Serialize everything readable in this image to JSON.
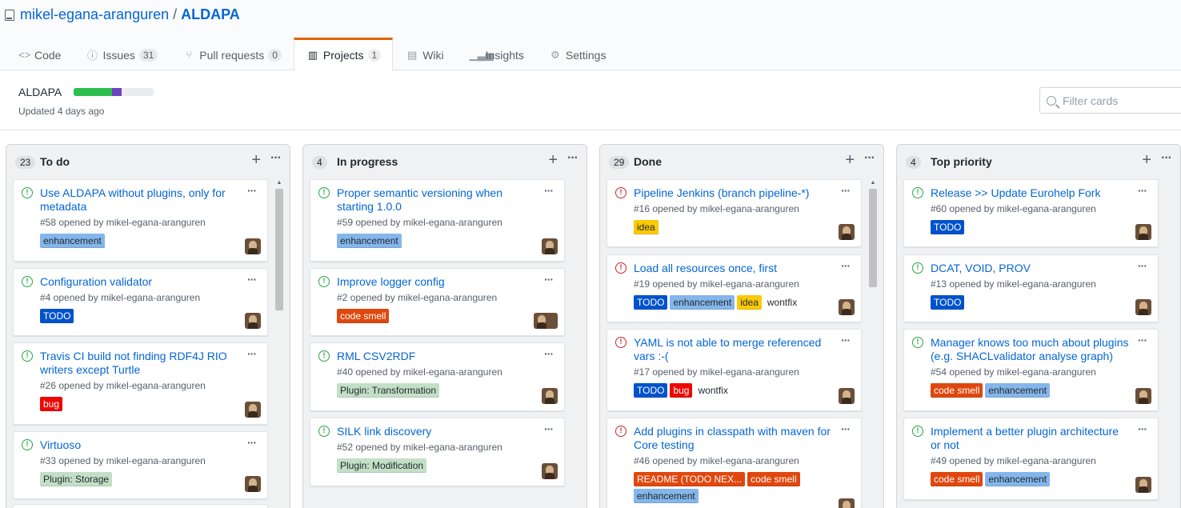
{
  "repo": {
    "owner": "mikel-egana-aranguren",
    "separator": "/",
    "name": "ALDAPA"
  },
  "tabs": [
    {
      "label": "Code",
      "counter": ""
    },
    {
      "label": "Issues",
      "counter": "31"
    },
    {
      "label": "Pull requests",
      "counter": "0"
    },
    {
      "label": "Projects",
      "counter": "1"
    },
    {
      "label": "Wiki",
      "counter": ""
    },
    {
      "label": "Insights",
      "counter": ""
    },
    {
      "label": "Settings",
      "counter": ""
    }
  ],
  "project": {
    "name": "ALDAPA",
    "updated": "Updated 4 days ago",
    "progress": {
      "done_fraction": 0.48,
      "in_progress_fraction": 0.12
    },
    "filter_placeholder": "Filter cards"
  },
  "colors": {
    "enhancement": "#84b6eb",
    "todo": "#0052cc",
    "bug": "#ee0701",
    "code_smell": "#e0470e",
    "plugin": "#c2e0c6",
    "idea": "#fbca04",
    "link": "#0366d6",
    "open": "#28a745",
    "closed": "#cb2431"
  },
  "columns": [
    {
      "title": "To do",
      "count": "23",
      "cards": [
        {
          "title": "Use ALDAPA without plugins, only for metadata",
          "meta": "#58 opened by mikel-egana-aranguren",
          "state": "open",
          "labels": [
            {
              "text": "enhancement",
              "kind": "enhancement"
            }
          ]
        },
        {
          "title": "Configuration validator",
          "meta": "#4 opened by mikel-egana-aranguren",
          "state": "open",
          "labels": [
            {
              "text": "TODO",
              "kind": "todo"
            }
          ]
        },
        {
          "title": "Travis CI build not finding RDF4J RIO writers except Turtle",
          "meta": "#26 opened by mikel-egana-aranguren",
          "state": "open",
          "labels": [
            {
              "text": "bug",
              "kind": "bug"
            }
          ]
        },
        {
          "title": "Virtuoso",
          "meta": "#33 opened by mikel-egana-aranguren",
          "state": "open",
          "labels": [
            {
              "text": "Plugin: Storage",
              "kind": "plugin"
            }
          ]
        }
      ]
    },
    {
      "title": "In progress",
      "count": "4",
      "cards": [
        {
          "title": "Proper semantic versioning when starting 1.0.0",
          "meta": "#59 opened by mikel-egana-aranguren",
          "state": "open",
          "labels": [
            {
              "text": "enhancement",
              "kind": "enhancement"
            }
          ]
        },
        {
          "title": "Improve logger config",
          "meta": "#2 opened by mikel-egana-aranguren",
          "state": "open",
          "labels": [
            {
              "text": "code smell",
              "kind": "code_smell"
            }
          ]
        },
        {
          "title": "RML CSV2RDF",
          "meta": "#40 opened by mikel-egana-aranguren",
          "state": "open",
          "labels": [
            {
              "text": "Plugin: Transformation",
              "kind": "plugin"
            }
          ]
        },
        {
          "title": "SILK link discovery",
          "meta": "#52 opened by mikel-egana-aranguren",
          "state": "open",
          "labels": [
            {
              "text": "Plugin: Modification",
              "kind": "plugin"
            }
          ]
        }
      ]
    },
    {
      "title": "Done",
      "count": "29",
      "cards": [
        {
          "title": "Pipeline Jenkins (branch pipeline-*)",
          "meta": "#16 opened by mikel-egana-aranguren",
          "state": "closed",
          "labels": [
            {
              "text": "idea",
              "kind": "idea"
            }
          ]
        },
        {
          "title": "Load all resources once, first",
          "meta": "#19 opened by mikel-egana-aranguren",
          "state": "closed",
          "labels": [
            {
              "text": "TODO",
              "kind": "todo"
            },
            {
              "text": "enhancement",
              "kind": "enhancement"
            },
            {
              "text": "idea",
              "kind": "idea"
            },
            {
              "text": "wontfix",
              "kind": "plain"
            }
          ]
        },
        {
          "title": "YAML is not able to merge referenced vars :-(",
          "meta": "#17 opened by mikel-egana-aranguren",
          "state": "closed",
          "labels": [
            {
              "text": "TODO",
              "kind": "todo"
            },
            {
              "text": "bug",
              "kind": "bug"
            },
            {
              "text": "wontfix",
              "kind": "plain"
            }
          ]
        },
        {
          "title": "Add plugins in classpath with maven for Core testing",
          "meta": "#46 opened by mikel-egana-aranguren",
          "state": "closed",
          "labels": [
            {
              "text": "README (TODO NEX...",
              "kind": "code_smell"
            },
            {
              "text": "code smell",
              "kind": "code_smell"
            },
            {
              "text": "enhancement",
              "kind": "enhancement"
            }
          ]
        }
      ]
    },
    {
      "title": "Top priority",
      "count": "4",
      "cards": [
        {
          "title": "Release >> Update Eurohelp Fork",
          "meta": "#60 opened by mikel-egana-aranguren",
          "state": "open",
          "labels": [
            {
              "text": "TODO",
              "kind": "todo"
            }
          ]
        },
        {
          "title": "DCAT, VOID, PROV",
          "meta": "#13 opened by mikel-egana-aranguren",
          "state": "open",
          "labels": [
            {
              "text": "TODO",
              "kind": "todo"
            }
          ]
        },
        {
          "title": "Manager knows too much about plugins (e.g. SHACLvalidator analyse graph)",
          "meta": "#54 opened by mikel-egana-aranguren",
          "state": "open",
          "labels": [
            {
              "text": "code smell",
              "kind": "code_smell"
            },
            {
              "text": "enhancement",
              "kind": "enhancement"
            }
          ]
        },
        {
          "title": "Implement a better plugin architecture or not",
          "meta": "#49 opened by mikel-egana-aranguren",
          "state": "open",
          "labels": [
            {
              "text": "code smell",
              "kind": "code_smell"
            },
            {
              "text": "enhancement",
              "kind": "enhancement"
            }
          ]
        }
      ]
    }
  ]
}
